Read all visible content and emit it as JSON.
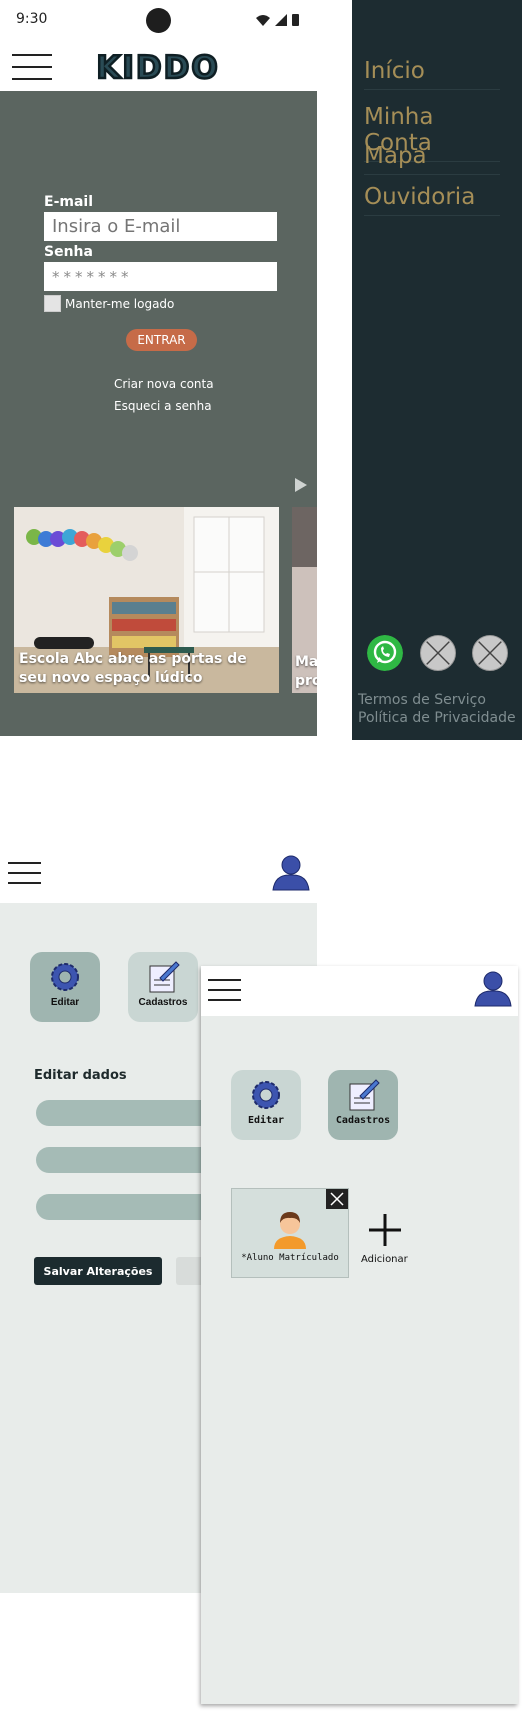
{
  "login_screen": {
    "status": {
      "time": "9:30"
    },
    "logo_text": "KIDDO",
    "form": {
      "email_label": "E-mail",
      "email_placeholder": "Insira o E-mail",
      "password_label": "Senha",
      "password_value": "*******",
      "keep_logged_label": "Manter-me logado",
      "submit_label": "ENTRAR"
    },
    "links": {
      "create_account": "Criar nova conta",
      "forgot_password": "Esqueci a senha"
    },
    "news": [
      {
        "caption": "Escola Abc abre as portas de seu novo espaço lúdico"
      },
      {
        "caption": "Ma pe pro"
      }
    ],
    "colors": {
      "background": "#5b6560",
      "accent": "#c66b48"
    }
  },
  "drawer_menu": {
    "items": [
      "Início",
      "Minha Conta",
      "Mapa",
      "Ouvidoria"
    ],
    "social": [
      "whatsapp-icon",
      "placeholder-icon",
      "placeholder-icon"
    ],
    "footer": {
      "terms": "Termos de Serviço",
      "privacy": "Política de Privacidade"
    },
    "colors": {
      "background": "#1d2c31",
      "item_text": "#a58e57"
    }
  },
  "edit_screen": {
    "tiles": [
      {
        "label": "Editar",
        "icon": "gear-icon"
      },
      {
        "label": "Cadastros",
        "icon": "document-icon"
      }
    ],
    "section_title": "Editar dados",
    "save_label": "Salvar Alterações"
  },
  "registrations_screen": {
    "tiles": [
      {
        "label": "Editar",
        "icon": "gear-icon"
      },
      {
        "label": "Cadastros",
        "icon": "document-icon"
      }
    ],
    "student_card": {
      "label": "*Aluno Matrículado"
    },
    "add_label": "Adicionar"
  }
}
